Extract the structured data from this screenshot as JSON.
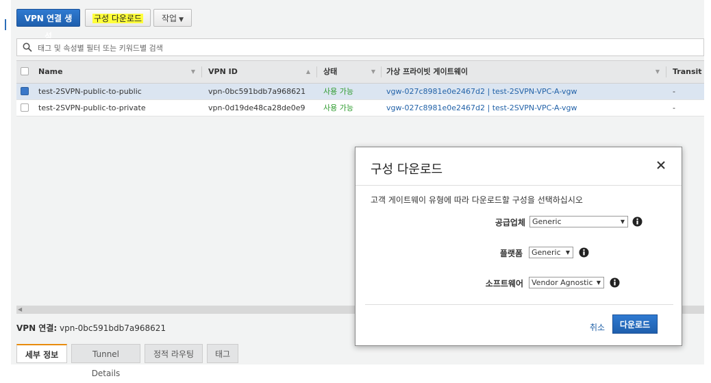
{
  "toolbar": {
    "create_label": "VPN 연결 생성",
    "download_label": "구성 다운로드",
    "actions_label": "작업"
  },
  "search": {
    "placeholder": "태그 및 속성별 필터 또는 키워드별 검색"
  },
  "table": {
    "headers": [
      "Name",
      "VPN ID",
      "상태",
      "가상 프라이빗 게이트웨이",
      "Transit Ga"
    ],
    "rows": [
      {
        "selected": true,
        "name": "test-2SVPN-public-to-public",
        "vpn_id": "vpn-0bc591bdb7a968621",
        "status": "사용 가능",
        "vgw": "vgw-027c8981e0e2467d2 | test-2SVPN-VPC-A-vgw",
        "transit": "-"
      },
      {
        "selected": false,
        "name": "test-2SVPN-public-to-private",
        "vpn_id": "vpn-0d19de48ca28de0e9",
        "status": "사용 가능",
        "vgw": "vgw-027c8981e0e2467d2 | test-2SVPN-VPC-A-vgw",
        "transit": "-"
      }
    ]
  },
  "detail": {
    "label": "VPN 연결:",
    "value": "vpn-0bc591bdb7a968621"
  },
  "tabs": [
    "세부 정보",
    "Tunnel Details",
    "정적 라우팅",
    "태그"
  ],
  "modal": {
    "title": "구성 다운로드",
    "description": "고객 게이트웨이 유형에 따라 다운로드할 구성을 선택하십시오",
    "vendor_label": "공급업체",
    "vendor_value": "Generic",
    "platform_label": "플랫폼",
    "platform_value": "Generic",
    "software_label": "소프트웨어",
    "software_value": "Vendor Agnostic",
    "cancel_label": "취소",
    "download_label": "다운로드"
  },
  "colors": {
    "accent": "#1f66b8",
    "status_ok": "#2e9b2e",
    "highlight": "#ffff3a",
    "tab_active": "#e88b0c"
  }
}
